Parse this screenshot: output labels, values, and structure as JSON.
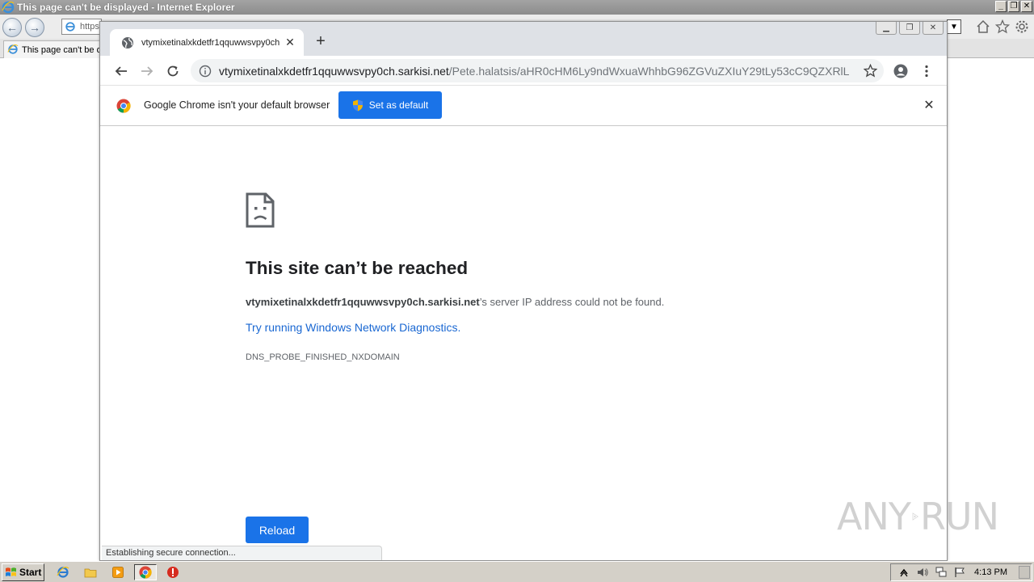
{
  "colors": {
    "chrome_blue": "#1a73e8",
    "link_blue": "#1967d2",
    "title_text": "#202124",
    "secondary_text": "#5f6368"
  },
  "ie": {
    "window_title": "This page can't be displayed - Internet Explorer",
    "address_value": "https:",
    "tab_title": "This page can't be d",
    "icons": [
      "ie-logo-icon",
      "back-icon",
      "forward-icon",
      "home-icon",
      "favorites-star-icon",
      "settings-gear-icon"
    ]
  },
  "chrome": {
    "tab_title": "vtymixetinalxkdetfr1qquwwsvpy0ch",
    "url_host": "vtymixetinalxkdetfr1qquwwsvpy0ch.sarkisi.net",
    "url_path": "/Pete.halatsis/aHR0cHM6Ly9ndWxuaWhhbG96ZGVuZXIuY29tLy53cC9QZXRlLi...",
    "infobar_message": "Google Chrome isn't your default browser",
    "set_default_label": "Set as default"
  },
  "error_page": {
    "title": "This site can’t be reached",
    "host": "vtymixetinalxkdetfr1qquwwsvpy0ch.sarkisi.net",
    "desc_suffix": "’s server IP address could not be found.",
    "diagnostics_link": "Try running Windows Network Diagnostics.",
    "error_code": "DNS_PROBE_FINISHED_NXDOMAIN",
    "reload_label": "Reload"
  },
  "status_bubble": "Establishing secure connection...",
  "watermark": {
    "left_text": "ANY",
    "right_text": "RUN"
  },
  "taskbar": {
    "start_label": "Start",
    "clock": "4:13 PM",
    "icons": [
      "ie-icon",
      "folder-icon",
      "media-player-icon",
      "chrome-icon",
      "stop-icon"
    ],
    "tray_icons": [
      "show-hidden-icon",
      "volume-icon",
      "network-icon",
      "flag-icon"
    ]
  }
}
